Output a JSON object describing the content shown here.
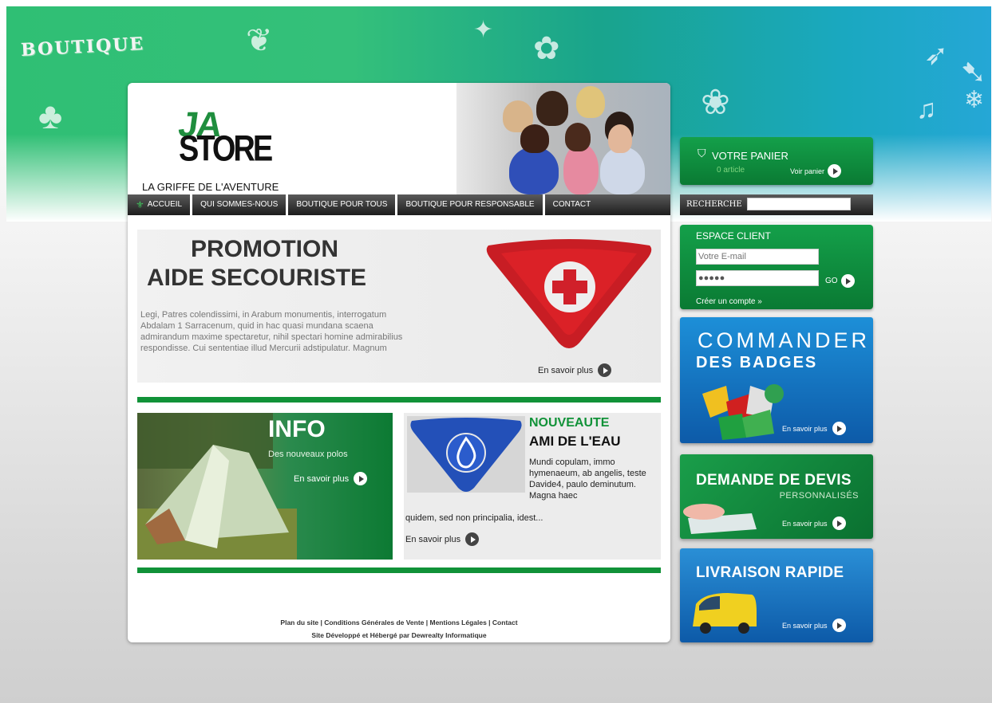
{
  "header": {
    "banner_word": "BOUTIQUE",
    "logo_top": "JA",
    "logo_bottom": "STORE",
    "tagline": "LA GRIFFE DE L'AVENTURE"
  },
  "nav": {
    "items": [
      "ACCUEIL",
      "QUI SOMMES-NOUS",
      "BOUTIQUE POUR TOUS",
      "BOUTIQUE POUR RESPONSABLE",
      "CONTACT"
    ]
  },
  "promo": {
    "title1": "PROMOTION",
    "title2": "AIDE SECOURISTE",
    "text": "Legi, Patres colendissimi, in Arabum monumentis, interrogatum Abdalam 1 Sarracenum, quid in hac quasi mundana scaena admirandum maxime spectaretur, nihil spectari homine admirabilius respondisse. Cui sententiae illud Mercurii adstipulatur. Magnum",
    "more": "En savoir plus"
  },
  "info": {
    "title": "INFO",
    "subtitle": "Des nouveaux polos",
    "more": "En savoir plus"
  },
  "nouveaute": {
    "kicker": "NOUVEAUTE",
    "title": "AMI DE L'EAU",
    "text_right": "Mundi copulam, immo hymenaeum, ab angelis, teste Davide4, paulo deminutum. Magna haec",
    "text_below": "quidem, sed non principalia, idest...",
    "more": "En savoir plus"
  },
  "footer": {
    "links": "Plan du site | Conditions Générales de Vente | Mentions Légales | Contact",
    "credit": "Site Développé et Hébergé par Dewrealty Informatique"
  },
  "cart": {
    "title": "VOTRE PANIER",
    "count": "0 article",
    "link": "Voir panier"
  },
  "search": {
    "label": "RECHERCHE"
  },
  "client": {
    "title": "ESPACE CLIENT",
    "email_placeholder": "Votre E-mail",
    "password_value": "●●●●●",
    "go": "GO",
    "create": "Créer un compte »"
  },
  "promo_boxes": {
    "commander_line1": "COMMANDER",
    "commander_line2": "DES BADGES",
    "devis_line1": "DEMANDE DE DEVIS",
    "devis_line2": "PERSONNALISÉS",
    "livraison": "LIVRAISON RAPIDE",
    "more": "En savoir plus"
  },
  "colors": {
    "accent_green": "#119238",
    "box_blue": "#0d5aa8",
    "nav_dark": "#1d1d1d"
  }
}
